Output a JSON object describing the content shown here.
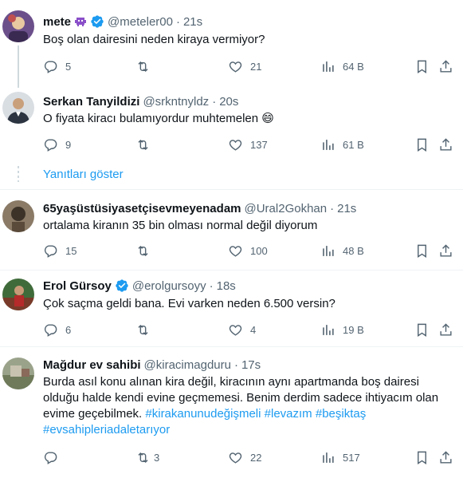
{
  "tweets": [
    {
      "name": "mete",
      "handle": "@meteler00",
      "time": "21s",
      "text": "Boş olan dairesini neden kiraya vermiyor?",
      "replies": "5",
      "retweets": "",
      "likes": "21",
      "views": "64 B",
      "verified": true,
      "badge_emoji": "alien-monster"
    },
    {
      "name": "Serkan Tanyildizi",
      "handle": "@srkntnyldz",
      "time": "20s",
      "text": "O fiyata kiracı bulamıyordur muhtemelen 😄",
      "replies": "9",
      "retweets": "",
      "likes": "137",
      "views": "61 B",
      "verified": false
    },
    {
      "name": "65yaşüstüsiyasetçisevmeyenadam",
      "handle": "@Ural2Gokhan",
      "time": "21s",
      "text": "ortalama kiranın 35 bin olması normal değil diyorum",
      "replies": "15",
      "retweets": "",
      "likes": "100",
      "views": "48 B",
      "verified": false
    },
    {
      "name": "Erol Gürsoy",
      "handle": "@erolgursoyy",
      "time": "18s",
      "text": "Çok saçma geldi bana. Evi varken neden 6.500 versin?",
      "replies": "6",
      "retweets": "",
      "likes": "4",
      "views": "19 B",
      "verified": true
    },
    {
      "name": "Mağdur ev sahibi",
      "handle": "@kiracimagduru",
      "time": "17s",
      "text_lines": [
        "Burda asıl konu alınan kira değil, kiracının aynı apartmanda boş dairesi",
        "olduğu halde kendi evine geçmemesi. Benim derdim sadece ihtiyacım olan",
        "evime geçebilmek."
      ],
      "hashtags": [
        "#kirakanunudeğişmeli",
        "#levazım",
        "#beşiktaş",
        "#evsahiplerиadaletarıyor"
      ],
      "replies": "",
      "retweets": "3",
      "likes": "22",
      "views": "517",
      "verified": false
    }
  ],
  "show_replies_label": "Yanıtları göster",
  "colors": {
    "accent": "#1d9bf0",
    "text": "#0f1419",
    "muted": "#536471",
    "divider": "#eff3f4"
  }
}
